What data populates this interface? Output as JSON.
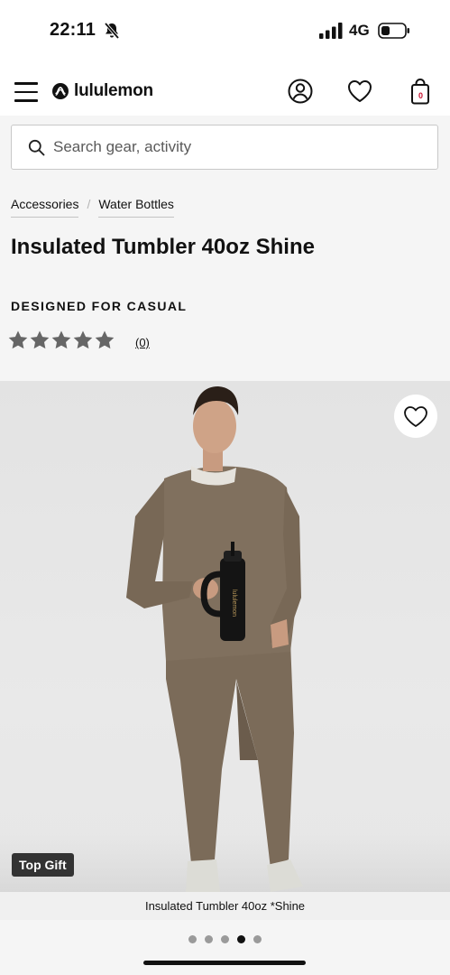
{
  "status_bar": {
    "time": "22:11",
    "network": "4G"
  },
  "header": {
    "brand": "lululemon",
    "bag_count": "0"
  },
  "search": {
    "placeholder": "Search gear, activity",
    "value": ""
  },
  "breadcrumbs": [
    {
      "label": "Accessories"
    },
    {
      "label": "Water Bottles"
    }
  ],
  "product": {
    "title": "Insulated Tumbler 40oz Shine",
    "activity": "DESIGNED FOR CASUAL",
    "rating_stars": 5,
    "review_count": "(0)"
  },
  "gallery": {
    "badge": "Top Gift",
    "caption": "Insulated Tumbler 40oz *Shine",
    "image_count": 5,
    "active_index": 3,
    "tumbler_text": "lululemon"
  },
  "colors": {
    "apparel": "#7a6a58",
    "background": "#e6e6e6",
    "badge": "#333333",
    "bag_count": "#c8102e"
  },
  "icons": [
    "menu-icon",
    "lululemon-logo-icon",
    "account-icon",
    "heart-icon",
    "bag-icon",
    "search-icon",
    "star-icon"
  ]
}
